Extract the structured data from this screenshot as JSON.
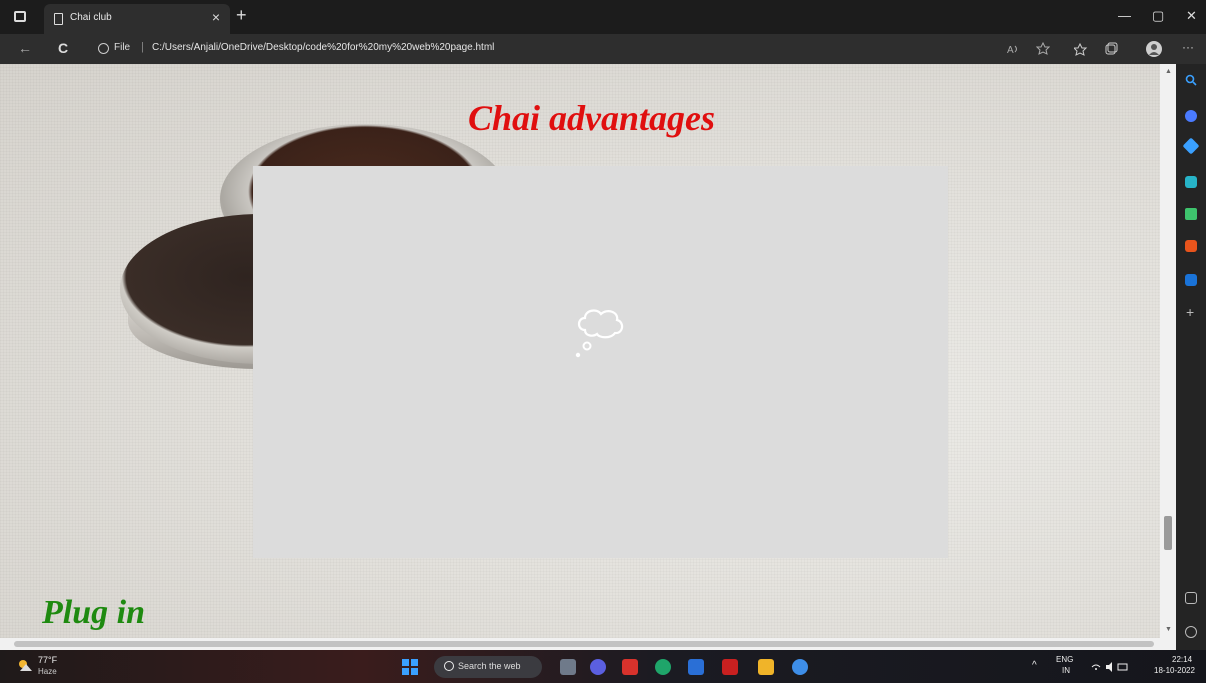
{
  "browser": {
    "tab_title": "Chai club",
    "tab_close": "×",
    "new_tab": "+",
    "url_label": "File",
    "url_separator": "|",
    "url": "C:/Users/Anjali/OneDrive/Desktop/code%20for%20my%20web%20page.html",
    "minimize": "—",
    "maximize": "▢",
    "close": "✕",
    "back": "←",
    "reload": "C",
    "more": "···"
  },
  "page": {
    "heading": "Chai advantages",
    "footer_heading": "Plug in"
  },
  "taskbar": {
    "weather_temp": "77°F",
    "weather_desc": "Haze",
    "search_label": "Search the web",
    "lang": "ENG",
    "region": "IN",
    "time": "22:14",
    "date": "18-10-2022"
  },
  "colors": {
    "heading": "#e00f0f",
    "footer_heading": "#1e8a10",
    "embed_bg": "#dcdcdc"
  }
}
